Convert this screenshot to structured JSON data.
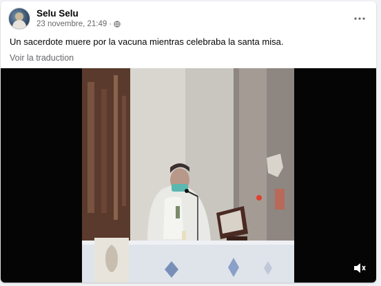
{
  "post": {
    "author": "Selu Selu",
    "date": "23 novembre, 21:49",
    "separator": "·",
    "privacy_icon": "globe-icon",
    "more_icon": "more-options-icon",
    "text": "Un sacerdote muere por la vacuna mientras celebraba la santa misa.",
    "translate_label": "Voir la traduction"
  },
  "video": {
    "volume_icon": "volume-muted-icon"
  }
}
